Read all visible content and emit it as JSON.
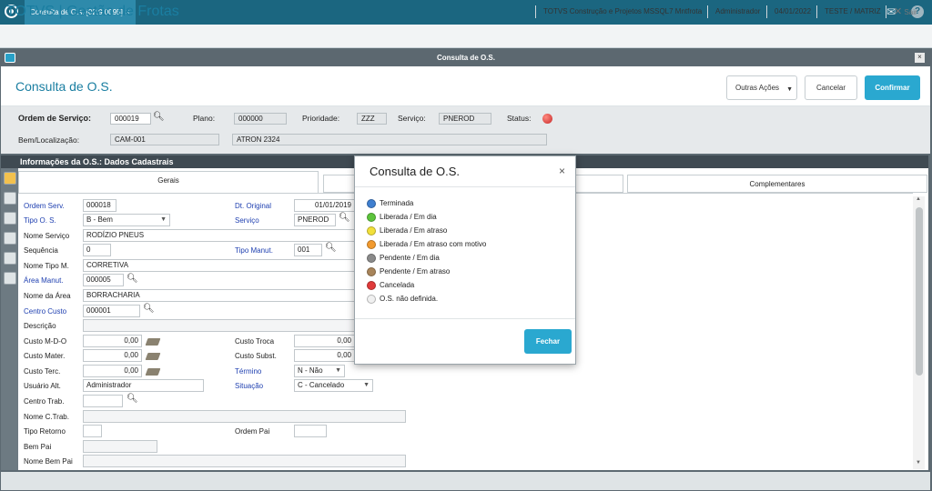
{
  "topbar": {
    "tab_label": "Consulta de O.s. [02.9.0095]",
    "tab_close": "×",
    "mail_icon": "mail-icon",
    "help_icon": "help-icon"
  },
  "brandbar": {
    "brand": "TOTVS | Gestão de Frotas",
    "company": "TOTVS Construção e Projetos MSSQL7 Mntfrota",
    "user": "Administrador",
    "date": "04/01/2022",
    "branch": "TESTE / MATRIZ",
    "exit": "Sair",
    "exit_icon": "close-icon"
  },
  "window": {
    "title": "Consulta de O.S.",
    "close": "×"
  },
  "header": {
    "page_title": "Consulta de O.S.",
    "other_actions": "Outras Ações",
    "cancel": "Cancelar",
    "confirm": "Confirmar"
  },
  "filter": {
    "os_label": "Ordem de Serviço:",
    "os_value": "000019",
    "plan_label": "Plano:",
    "plan_value": "000000",
    "priority_label": "Prioridade:",
    "priority_value": "ZZZ",
    "service_label": "Serviço:",
    "service_value": "PNEROD",
    "status_label": "Status:",
    "asset_label": "Bem/Localização:",
    "asset_value": "CAM-001",
    "asset_desc": "ATRON 2324",
    "status_color": "#d32f2f"
  },
  "section": {
    "title": "Informações da O.S.: Dados Cadastrais"
  },
  "tabs": [
    "Gerais",
    "",
    "",
    "Complementares"
  ],
  "form": {
    "ordem_serv_label": "Ordem Serv.",
    "ordem_serv": "000018",
    "dt_original_label": "Dt. Original",
    "dt_original": "01/01/2019",
    "tipo_os_label": "Tipo O. S.",
    "tipo_os": "B - Bem",
    "servico_label": "Serviço",
    "servico": "PNEROD",
    "nome_servico_label": "Nome Serviço",
    "nome_servico": "RODÍZIO PNEUS",
    "sequencia_label": "Sequência",
    "sequencia": "0",
    "tipo_manut_label": "Tipo Manut.",
    "tipo_manut": "001",
    "nome_tipo_m_label": "Nome Tipo M.",
    "nome_tipo_m": "CORRETIVA",
    "area_manut_label": "Área Manut.",
    "area_manut": "000005",
    "nome_area_label": "Nome da Área",
    "nome_area": "BORRACHARIA",
    "centro_custo_label": "Centro Custo",
    "centro_custo": "000001",
    "descricao_label": "Descrição",
    "custo_mdo_label": "Custo M-D-O",
    "custo_mdo": "0,00",
    "custo_troca_label": "Custo Troca",
    "custo_troca": "0,00",
    "custo_mater_label": "Custo Mater.",
    "custo_mater": "0,00",
    "custo_subst_label": "Custo Subst.",
    "custo_subst": "0,00",
    "custo_terc_label": "Custo Terc.",
    "custo_terc": "0,00",
    "termino_label": "Término",
    "termino": "N - Não",
    "usuario_alt_label": "Usuário Alt.",
    "usuario_alt": "Administrador",
    "situacao_label": "Situação",
    "situacao": "C - Cancelado",
    "centro_trab_label": "Centro Trab.",
    "nome_ctrab_label": "Nome C.Trab.",
    "tipo_retorno_label": "Tipo Retorno",
    "ordem_pai_label": "Ordem Pai",
    "bem_pai_label": "Bem Pai",
    "nome_bem_pai_label": "Nome Bem Pai"
  },
  "modal": {
    "title": "Consulta de O.S.",
    "close": "×",
    "close_button": "Fechar",
    "legend": [
      {
        "label": "Terminada",
        "color": "#3f7fd0"
      },
      {
        "label": "Liberada / Em dia",
        "color": "#5cc43c"
      },
      {
        "label": "Liberada / Em atraso",
        "color": "#f2e03a"
      },
      {
        "label": "Liberada / Em atraso com motivo",
        "color": "#f29a2e"
      },
      {
        "label": "Pendente / Em dia",
        "color": "#8a8a8a"
      },
      {
        "label": "Pendente / Em atraso",
        "color": "#a8845a"
      },
      {
        "label": "Cancelada",
        "color": "#e03a3a"
      },
      {
        "label": "O.S. não definida.",
        "color": "#f0f0f0"
      }
    ]
  }
}
